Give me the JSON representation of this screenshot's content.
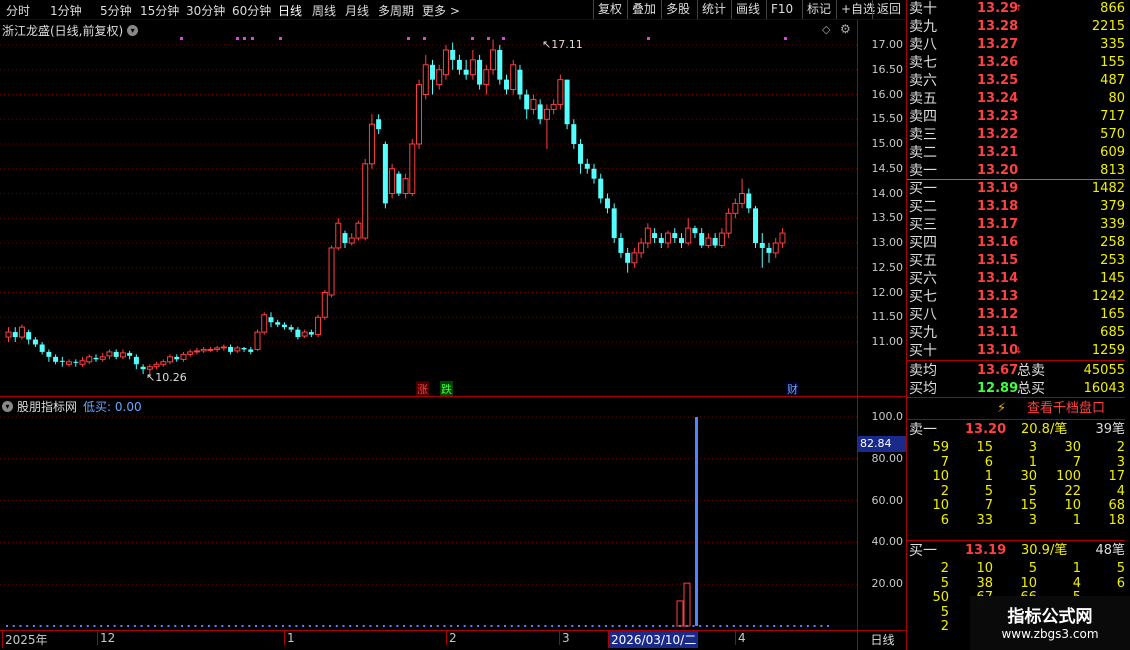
{
  "toolbar": {
    "periods": [
      "分时",
      "1分钟",
      "5分钟",
      "15分钟",
      "30分钟",
      "60分钟",
      "日线",
      "周线",
      "月线",
      "多周期",
      "更多 >"
    ],
    "active_period": "日线",
    "actions": [
      "复权",
      "叠加",
      "多股",
      "统计",
      "画线",
      "F10",
      "标记",
      "+自选",
      "返回"
    ]
  },
  "chart": {
    "stock_title": "浙江龙盛(日线,前复权)",
    "max_label": "17.11",
    "min_label": "10.26",
    "y_labels": [
      "17.00",
      "16.50",
      "16.00",
      "15.50",
      "15.00",
      "14.50",
      "14.00",
      "13.50",
      "13.00",
      "12.50",
      "12.00",
      "11.50",
      "11.00"
    ],
    "markers": [
      {
        "text": "涨",
        "color": "#ff4040"
      },
      {
        "text": "跌",
        "color": "#40ff40"
      },
      {
        "text": "财",
        "color": "#6aa6ff"
      }
    ]
  },
  "sub_chart": {
    "name": "股朋指标网",
    "indicator_label": "低买: 0.00",
    "y_labels": [
      "100.0",
      "80.00",
      "60.00",
      "40.00",
      "20.00"
    ],
    "cursor_value": "82.84"
  },
  "time_axis": {
    "labels": [
      "2025年",
      "12",
      "1",
      "2",
      "3",
      "2026/03/10/二",
      "4"
    ],
    "period": "日线"
  },
  "order_book": {
    "sell": [
      {
        "label": "卖十",
        "price": "13.29",
        "vol": "866"
      },
      {
        "label": "卖九",
        "price": "13.28",
        "vol": "2215"
      },
      {
        "label": "卖八",
        "price": "13.27",
        "vol": "335"
      },
      {
        "label": "卖七",
        "price": "13.26",
        "vol": "155"
      },
      {
        "label": "卖六",
        "price": "13.25",
        "vol": "487"
      },
      {
        "label": "卖五",
        "price": "13.24",
        "vol": "80"
      },
      {
        "label": "卖四",
        "price": "13.23",
        "vol": "717"
      },
      {
        "label": "卖三",
        "price": "13.22",
        "vol": "570"
      },
      {
        "label": "卖二",
        "price": "13.21",
        "vol": "609"
      },
      {
        "label": "卖一",
        "price": "13.20",
        "vol": "813"
      }
    ],
    "buy": [
      {
        "label": "买一",
        "price": "13.19",
        "vol": "1482"
      },
      {
        "label": "买二",
        "price": "13.18",
        "vol": "379"
      },
      {
        "label": "买三",
        "price": "13.17",
        "vol": "339"
      },
      {
        "label": "买四",
        "price": "13.16",
        "vol": "258"
      },
      {
        "label": "买五",
        "price": "13.15",
        "vol": "253"
      },
      {
        "label": "买六",
        "price": "13.14",
        "vol": "145"
      },
      {
        "label": "买七",
        "price": "13.13",
        "vol": "1242"
      },
      {
        "label": "买八",
        "price": "13.12",
        "vol": "165"
      },
      {
        "label": "买九",
        "price": "13.11",
        "vol": "685"
      },
      {
        "label": "买十",
        "price": "13.10",
        "vol": "1259"
      }
    ],
    "sell_avg_label": "卖均",
    "sell_avg": "13.67",
    "total_sell_label": "总卖",
    "total_sell": "45055",
    "buy_avg_label": "买均",
    "buy_avg": "12.89",
    "total_buy_label": "总买",
    "total_buy": "16043",
    "depth_button": "查看千档盘口",
    "ask1_label": "卖一",
    "ask1_price": "13.20",
    "ask1_per": "20.8/笔",
    "ask1_count": "39笔",
    "ask_queue": [
      [
        "59",
        "15",
        "3",
        "30",
        "2"
      ],
      [
        "7",
        "6",
        "1",
        "7",
        "3"
      ],
      [
        "10",
        "1",
        "30",
        "100",
        "17"
      ],
      [
        "2",
        "5",
        "5",
        "22",
        "4"
      ],
      [
        "10",
        "7",
        "15",
        "10",
        "68"
      ],
      [
        "6",
        "33",
        "3",
        "1",
        "18"
      ]
    ],
    "bid1_label": "买一",
    "bid1_price": "13.19",
    "bid1_per": "30.9/笔",
    "bid1_count": "48笔",
    "bid_queue": [
      [
        "2",
        "10",
        "5",
        "1",
        "5"
      ],
      [
        "5",
        "38",
        "10",
        "4",
        "6"
      ],
      [
        "50",
        "67",
        "66",
        "5",
        ""
      ],
      [
        "5",
        "",
        "",
        "",
        ""
      ],
      [
        "2",
        "",
        "",
        "",
        ""
      ]
    ]
  },
  "watermark": {
    "title": "指标公式网",
    "url": "www.zbgs3.com"
  },
  "colors": {
    "up": "#ff4040",
    "down": "#54ffff",
    "grid": "#a00000",
    "bar": "#4f86ff"
  }
}
